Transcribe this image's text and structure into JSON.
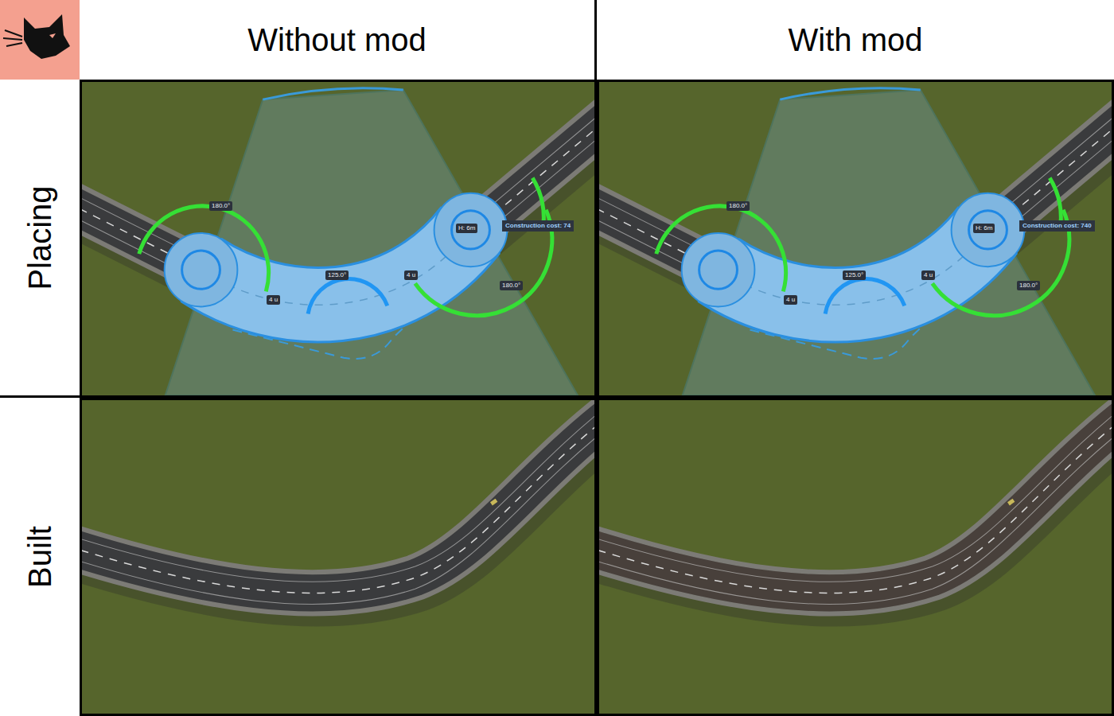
{
  "columns": [
    {
      "label": "Without mod",
      "modded": false,
      "cost": "Construction cost: 74"
    },
    {
      "label": "With mod",
      "modded": true,
      "cost": "Construction cost: 740"
    }
  ],
  "rows": [
    {
      "label": "Placing",
      "kind": "placing"
    },
    {
      "label": "Built",
      "kind": "built"
    }
  ],
  "placing_labels": {
    "start_angle": "180.0°",
    "end_angle": "180.0°",
    "curve_angle": "125.0°",
    "start_length": "4 u",
    "end_length": "4 u",
    "height": "H: 6m"
  }
}
